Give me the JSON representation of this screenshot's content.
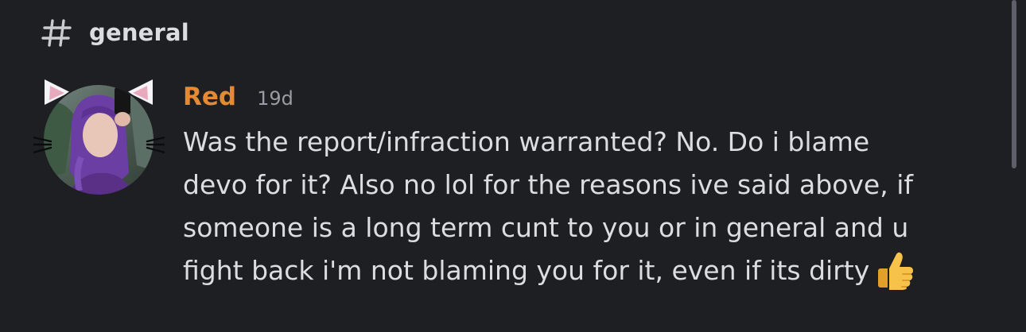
{
  "channel": {
    "icon": "hash-icon",
    "name": "general"
  },
  "message": {
    "author": "Red",
    "author_color": "#e38a32",
    "timestamp": "19d",
    "avatar_icon": "cat-ears-avatar",
    "lines": [
      "Was the report/infraction warranted? No. Do i blame",
      "devo for it? Also no lol for the reasons ive said above, if",
      "someone is a long term cunt to you or in general and u",
      "fight back i'm not blaming you for it, even if its dirty"
    ],
    "emoji": "thumbs-up-icon"
  },
  "colors": {
    "background": "#1e1f23",
    "text": "#dcdde0",
    "muted": "#9a9ca3"
  }
}
